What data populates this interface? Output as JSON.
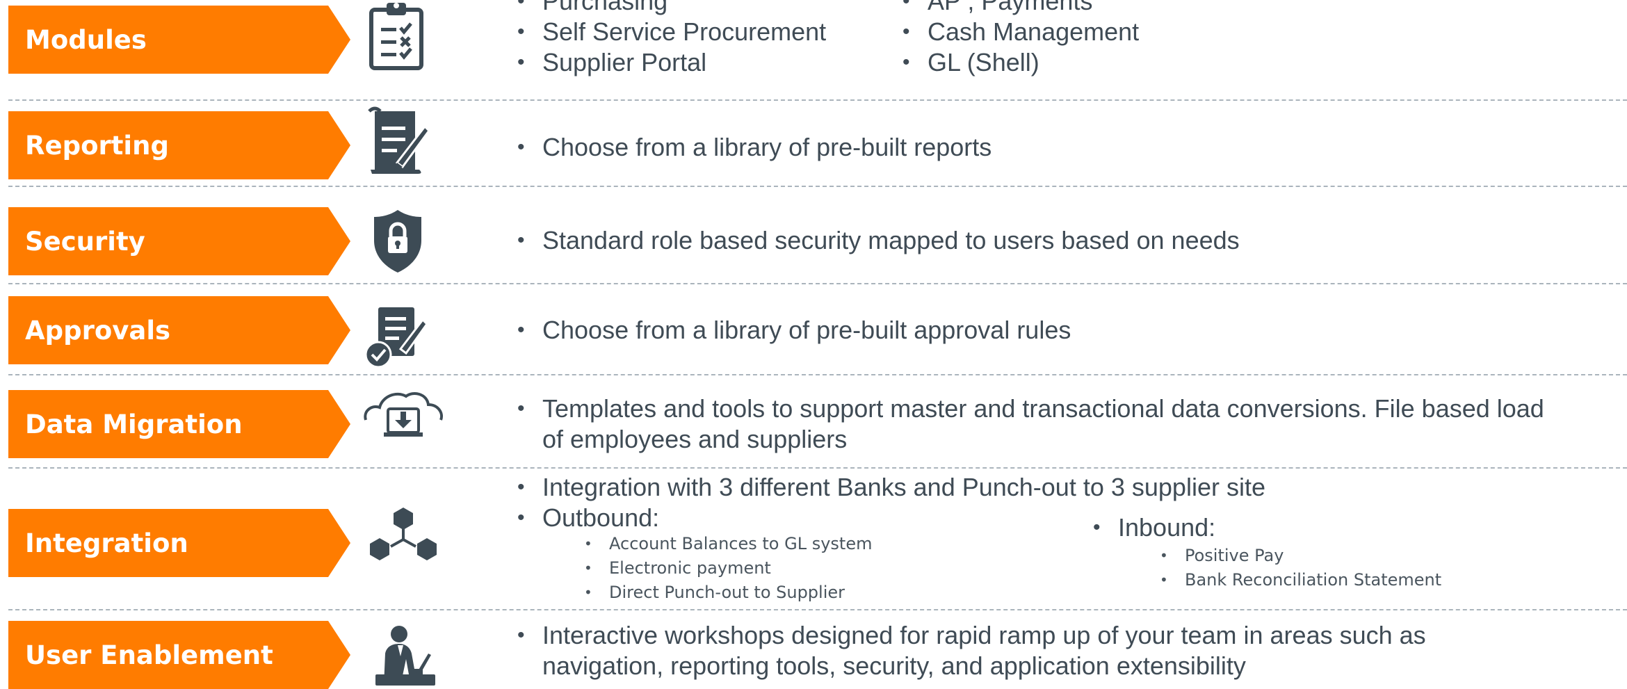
{
  "rows": [
    {
      "label": "Modules",
      "icon": "checklist-icon",
      "col1": [
        "Purchasing",
        "Self Service Procurement",
        "Supplier Portal"
      ],
      "col2": [
        "AP , Payments",
        "Cash Management",
        "GL (Shell)"
      ]
    },
    {
      "label": "Reporting",
      "icon": "document-pen-icon",
      "items": [
        "Choose from a library of pre-built reports"
      ]
    },
    {
      "label": "Security",
      "icon": "shield-lock-icon",
      "items": [
        "Standard role based security mapped to users based on needs"
      ]
    },
    {
      "label": "Approvals",
      "icon": "approval-document-icon",
      "items": [
        "Choose from a library of pre-built approval rules"
      ]
    },
    {
      "label": "Data Migration",
      "icon": "cloud-download-icon",
      "items": [
        "Templates and tools to support master and transactional data conversions. File based load of employees and suppliers"
      ]
    },
    {
      "label": "Integration",
      "icon": "hexagon-network-icon",
      "items": [
        "Integration with 3 different Banks  and Punch-out to 3 supplier site"
      ],
      "outbound": {
        "title": "Outbound:",
        "items": [
          "Account Balances to GL system",
          "Electronic payment",
          "Direct Punch-out to Supplier"
        ]
      },
      "inbound": {
        "title": "Inbound:",
        "items": [
          "Positive Pay",
          "Bank Reconciliation Statement"
        ]
      }
    },
    {
      "label": "User Enablement",
      "icon": "user-at-laptop-icon",
      "items": [
        "Interactive workshops designed for rapid ramp up of your team in areas such as navigation, reporting tools, security, and application extensibility"
      ]
    }
  ],
  "colors": {
    "accent": "#ff7c00",
    "icon": "#3d4b55",
    "divider": "#aab4bc"
  }
}
